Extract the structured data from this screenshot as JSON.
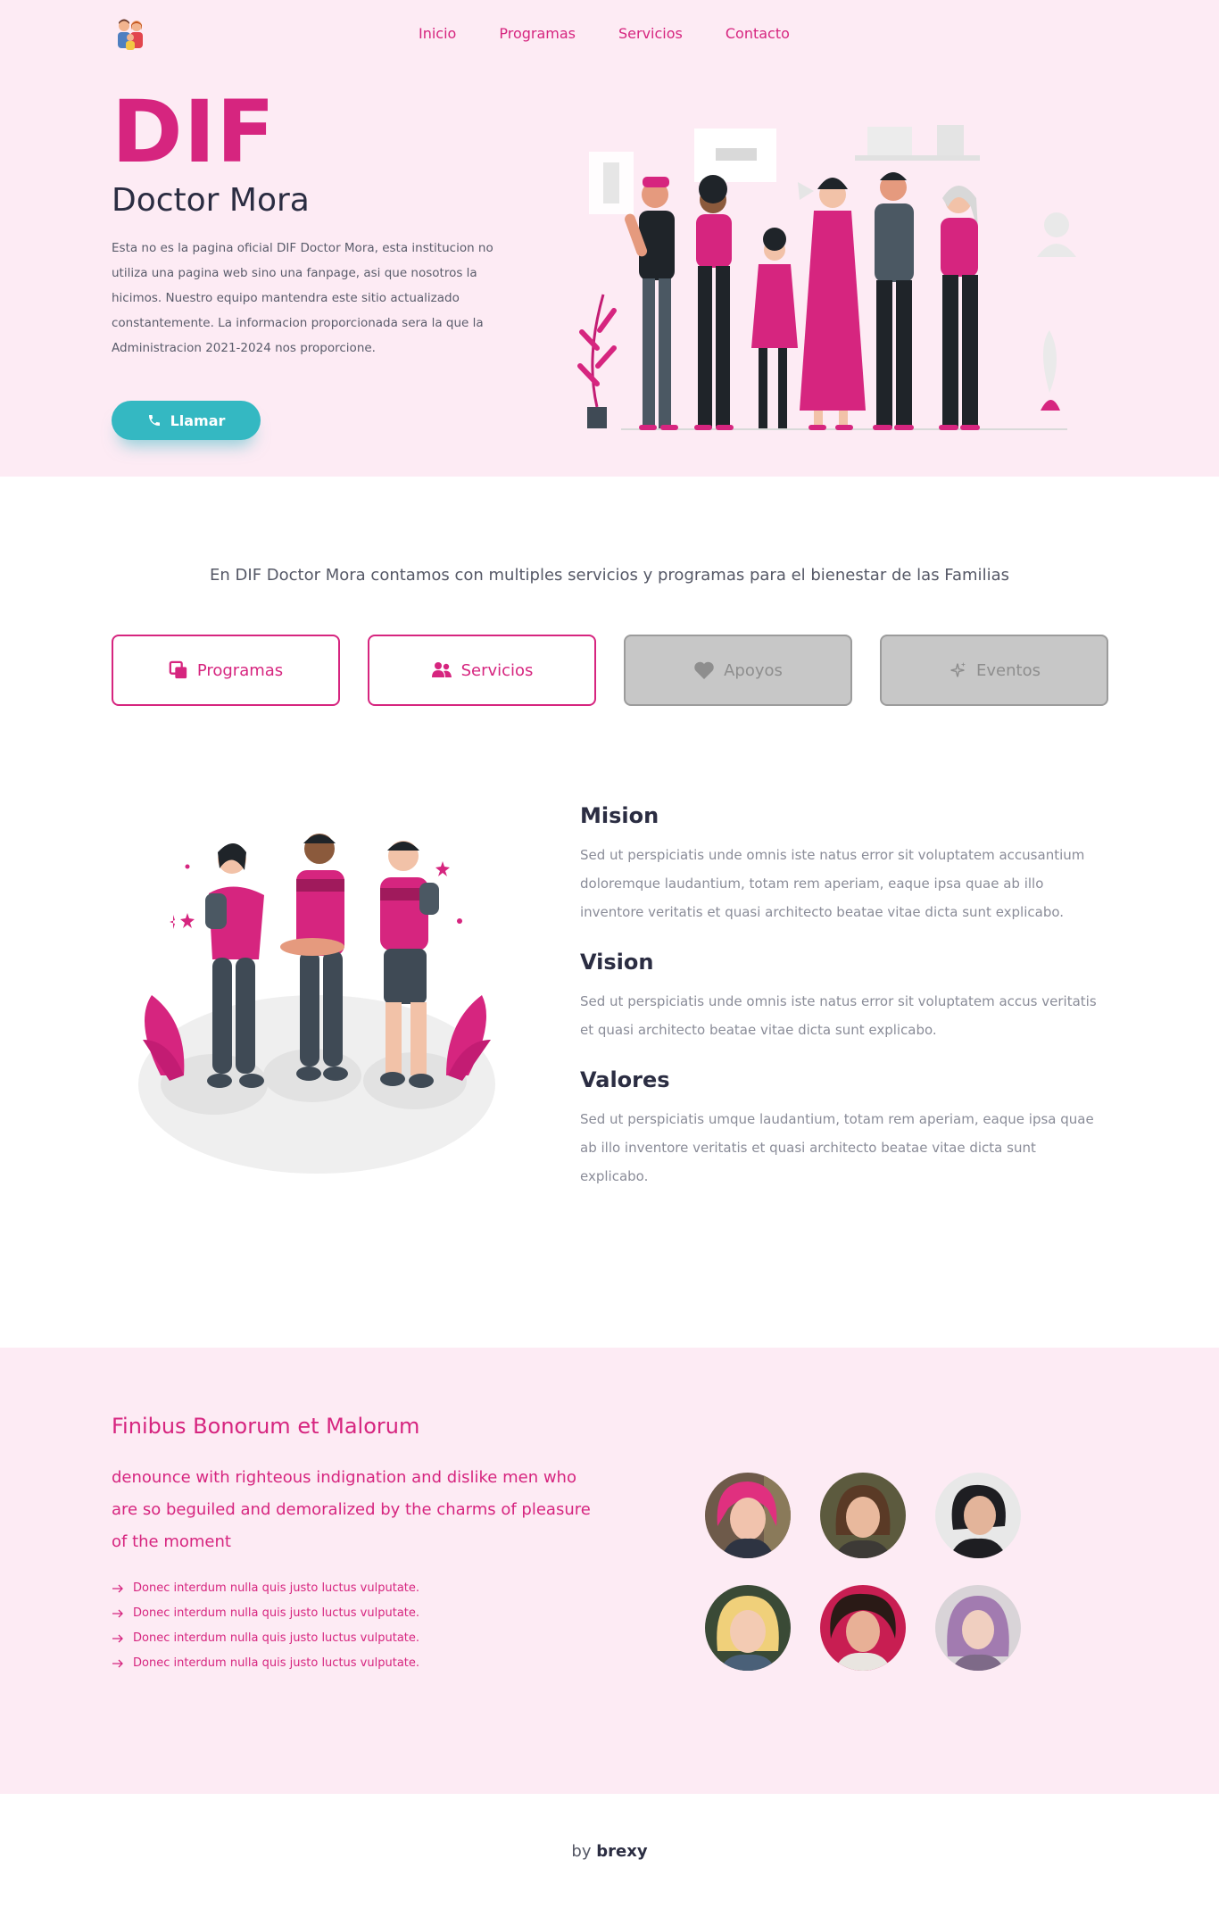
{
  "nav": {
    "logo_icon": "family-icon",
    "links": [
      "Inicio",
      "Programas",
      "Servicios",
      "Contacto"
    ]
  },
  "hero": {
    "title": "DIF",
    "subtitle": "Doctor Mora",
    "description": "Esta no es la pagina oficial DIF Doctor Mora, esta institucion no utiliza una pagina web sino una fanpage, asi que nosotros la hicimos. Nuestro equipo mantendra este sitio actualizado constantemente. La informacion proporcionada sera la que la Administracion 2021-2024 nos proporcione.",
    "call_button": "Llamar",
    "call_icon": "phone-icon"
  },
  "intro": {
    "text": "En DIF Doctor Mora contamos con multiples servicios y programas para el bienestar de las Familias"
  },
  "cards": [
    {
      "label": "Programas",
      "icon": "copy-icon",
      "active": true
    },
    {
      "label": "Servicios",
      "icon": "users-icon",
      "active": true
    },
    {
      "label": "Apoyos",
      "icon": "heart-icon",
      "active": false
    },
    {
      "label": "Eventos",
      "icon": "sparkle-icon",
      "active": false
    }
  ],
  "about": {
    "mision_title": "Mision",
    "mision_text": "Sed ut perspiciatis unde omnis iste natus error sit voluptatem accusantium doloremque laudantium, totam rem aperiam, eaque ipsa quae ab illo inventore veritatis et quasi architecto beatae vitae dicta sunt explicabo.",
    "vision_title": "Vision",
    "vision_text": "Sed ut perspiciatis unde omnis iste natus error sit voluptatem accus veritatis et quasi architecto beatae vitae dicta sunt explicabo.",
    "valores_title": "Valores",
    "valores_text": "Sed ut perspiciatis umque laudantium, totam rem aperiam, eaque ipsa quae ab illo inventore veritatis et quasi architecto beatae vitae dicta sunt explicabo."
  },
  "team": {
    "title": "Finibus Bonorum et Malorum",
    "lead": "denounce with righteous indignation and dislike men who are so beguiled and demoralized by the charms of pleasure of the moment",
    "items": [
      "Donec interdum nulla quis justo luctus vulputate.",
      "Donec interdum nulla quis justo luctus vulputate.",
      "Donec interdum nulla quis justo luctus vulputate.",
      "Donec interdum nulla quis justo luctus vulputate."
    ]
  },
  "footer": {
    "by": "by",
    "brand": "brexy"
  },
  "colors": {
    "accent": "#d6257f",
    "hero_bg": "#fdebf4",
    "teal": "#34b8c2"
  }
}
